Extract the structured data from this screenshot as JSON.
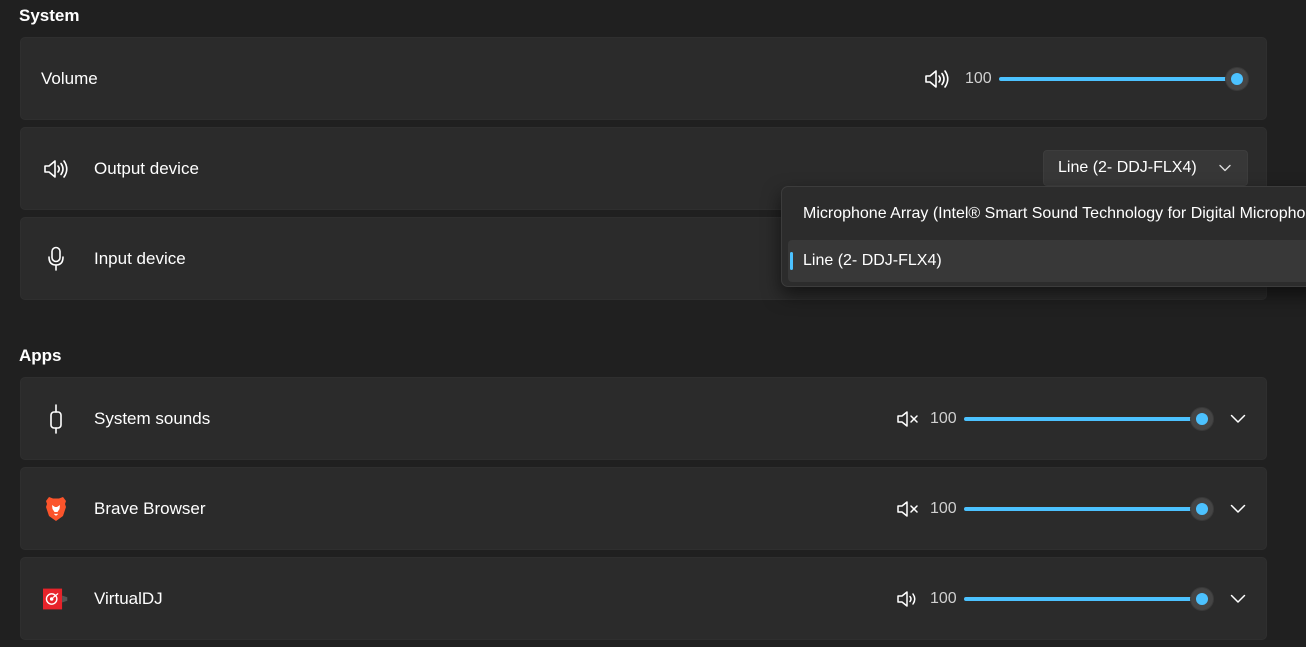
{
  "system": {
    "section_title": "System",
    "volume": {
      "label": "Volume",
      "value": "100",
      "level": 100,
      "icon": "speaker-icon"
    },
    "output_device": {
      "label": "Output device",
      "selected": "Line (2- DDJ-FLX4)",
      "icon": "speaker-icon"
    },
    "input_device": {
      "label": "Input device",
      "icon": "microphone-icon"
    }
  },
  "dropdown": {
    "options": [
      {
        "label": "Microphone Array (Intel® Smart Sound Technology for Digital Microphones)",
        "selected": false
      },
      {
        "label": "Line (2- DDJ-FLX4)",
        "selected": true
      }
    ]
  },
  "apps": {
    "section_title": "Apps",
    "items": [
      {
        "name": "System sounds",
        "value": "100",
        "level": 100,
        "muted": true,
        "icon": "system-sounds-icon"
      },
      {
        "name": "Brave Browser",
        "value": "100",
        "level": 100,
        "muted": true,
        "icon": "brave-icon"
      },
      {
        "name": "VirtualDJ",
        "value": "100",
        "level": 100,
        "muted": false,
        "icon": "virtualdj-icon"
      }
    ]
  },
  "colors": {
    "accent": "#4cc2ff",
    "card": "#2b2b2b",
    "background": "#202020",
    "brave": "#fb542b",
    "virtualdj": "#e8232a"
  }
}
